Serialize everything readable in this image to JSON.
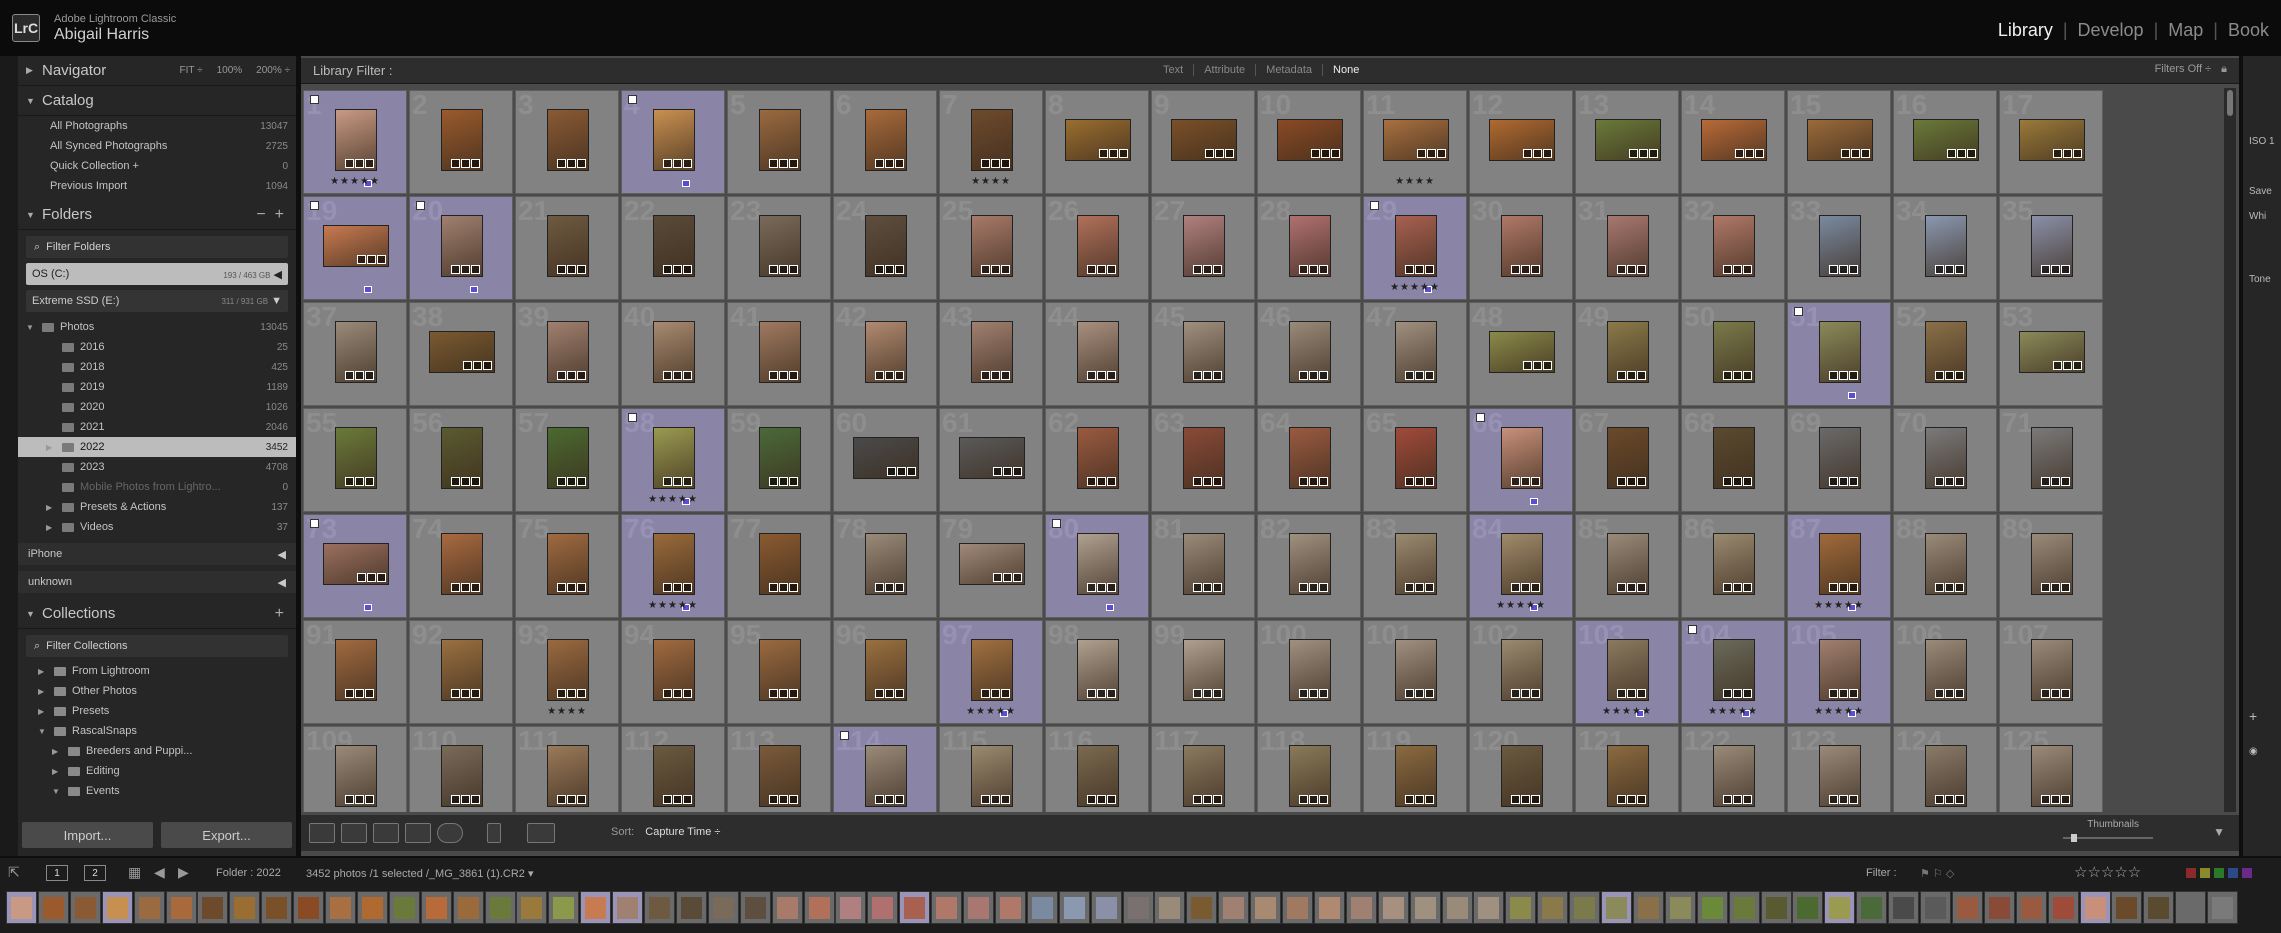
{
  "app": {
    "name": "Adobe Lightroom Classic",
    "user": "Abigail Harris",
    "logo": "LrC"
  },
  "modules": [
    {
      "label": "Library",
      "active": true
    },
    {
      "label": "Develop"
    },
    {
      "label": "Map"
    },
    {
      "label": "Book"
    }
  ],
  "navigator": {
    "title": "Navigator",
    "opts": [
      "FIT ÷",
      "100%",
      "200% ÷"
    ]
  },
  "catalog": {
    "title": "Catalog",
    "items": [
      {
        "label": "All Photographs",
        "count": "13047"
      },
      {
        "label": "All Synced Photographs",
        "count": "2725"
      },
      {
        "label": "Quick Collection +",
        "count": "0"
      },
      {
        "label": "Previous Import",
        "count": "1094"
      }
    ]
  },
  "folders": {
    "title": "Folders",
    "filter": "Filter Folders",
    "volumes": [
      {
        "name": "OS (C:)",
        "usage": "193 / 463 GB"
      },
      {
        "name": "Extreme SSD (E:)",
        "usage": "311 / 931 GB"
      }
    ],
    "items": [
      {
        "label": "Photos",
        "count": "13045",
        "level": 0,
        "tri": "▼"
      },
      {
        "label": "2016",
        "count": "25",
        "level": 1
      },
      {
        "label": "2018",
        "count": "425",
        "level": 1
      },
      {
        "label": "2019",
        "count": "1189",
        "level": 1
      },
      {
        "label": "2020",
        "count": "1026",
        "level": 1
      },
      {
        "label": "2021",
        "count": "2046",
        "level": 1
      },
      {
        "label": "2022",
        "count": "3452",
        "level": 1,
        "tri": "▶",
        "sel": true
      },
      {
        "label": "2023",
        "count": "4708",
        "level": 1
      },
      {
        "label": "Mobile Photos from Lightro...",
        "count": "0",
        "level": 1,
        "dim": true
      },
      {
        "label": "Presets & Actions",
        "count": "137",
        "level": 1,
        "tri": "▶"
      },
      {
        "label": "Videos",
        "count": "37",
        "level": 1,
        "tri": "▶"
      }
    ],
    "devices": [
      {
        "label": "iPhone"
      },
      {
        "label": "unknown"
      }
    ]
  },
  "collections": {
    "title": "Collections",
    "filter": "Filter Collections",
    "items": [
      {
        "label": "From Lightroom",
        "level": 0
      },
      {
        "label": "Other Photos",
        "level": 0
      },
      {
        "label": "Presets",
        "level": 0
      },
      {
        "label": "RascalSnaps",
        "level": 0,
        "open": true
      },
      {
        "label": "Breeders and Puppi...",
        "level": 1
      },
      {
        "label": "Editing",
        "level": 1
      },
      {
        "label": "Events",
        "level": 1,
        "open": true
      }
    ]
  },
  "buttons": {
    "import": "Import...",
    "export": "Export..."
  },
  "filterbar": {
    "title": "Library Filter :",
    "tabs": [
      "Text",
      "Attribute",
      "Metadata",
      "None"
    ],
    "right": "Filters Off ÷"
  },
  "toolbar": {
    "sort_label": "Sort:",
    "sort_value": "Capture Time ÷",
    "thumbs": "Thumbnails"
  },
  "status": {
    "page1": "1",
    "page2": "2",
    "folder": "Folder : 2022",
    "info": "3452 photos /1 selected /_MG_3861 (1).CR2 ▾",
    "filter": "Filter :",
    "stars": "☆☆☆☆☆"
  },
  "right_panel": {
    "items": [
      "Save",
      "Whi",
      "Tone",
      "ISO 1"
    ]
  },
  "colors": {
    "selection": "#8a84a6",
    "panel": "#262626",
    "grid": "#828282",
    "label_purple": "#5a4fd0"
  },
  "grid_rows": [
    {
      "start": 1,
      "cells": [
        {
          "o": "port",
          "c": "#c89a84",
          "sel": true,
          "stars": "★★★★★",
          "label": true,
          "flag": true
        },
        {
          "o": "port",
          "c": "#9a5a2c"
        },
        {
          "o": "port",
          "c": "#8a5a34"
        },
        {
          "o": "port",
          "c": "#c89050",
          "sel": true,
          "label": true,
          "flag": true
        },
        {
          "o": "port",
          "c": "#9a6a40"
        },
        {
          "o": "port",
          "c": "#a86a3a"
        },
        {
          "o": "port",
          "c": "#6e4a2c",
          "stars": "★★★★"
        },
        {
          "o": "land",
          "c": "#9a6e30"
        },
        {
          "o": "land",
          "c": "#7a5028"
        },
        {
          "o": "land",
          "c": "#8a4a24"
        },
        {
          "o": "land",
          "c": "#a87040",
          "stars": "★★★★"
        },
        {
          "o": "land",
          "c": "#b06a30"
        },
        {
          "o": "land",
          "c": "#6a7a3a"
        },
        {
          "o": "land",
          "c": "#b86a38"
        },
        {
          "o": "land",
          "c": "#9a6a3a"
        },
        {
          "o": "land",
          "c": "#6a7a3a"
        },
        {
          "o": "land",
          "c": "#9a7a3a"
        },
        {
          "o": "land",
          "c": "#8a9a4a"
        }
      ]
    },
    {
      "start": 19,
      "cells": [
        {
          "o": "land",
          "c": "#c87a50",
          "sel": true,
          "label": true,
          "flag": true
        },
        {
          "o": "port",
          "c": "#a08070",
          "sel": true,
          "label": true,
          "flag": true
        },
        {
          "o": "port",
          "c": "#6e5a40"
        },
        {
          "o": "port",
          "c": "#5a4a38"
        },
        {
          "o": "port",
          "c": "#7a6a5a"
        },
        {
          "o": "port",
          "c": "#5e4e40"
        },
        {
          "o": "port",
          "c": "#a87a6a"
        },
        {
          "o": "port",
          "c": "#b0705a"
        },
        {
          "o": "port",
          "c": "#b08080"
        },
        {
          "o": "port",
          "c": "#b07070"
        },
        {
          "o": "port",
          "c": "#a86050",
          "sel": true,
          "stars": "★★★★★",
          "label": true,
          "flag": true
        },
        {
          "o": "port",
          "c": "#b07868"
        },
        {
          "o": "port",
          "c": "#a87870"
        },
        {
          "o": "port",
          "c": "#b07868"
        },
        {
          "o": "port",
          "c": "#7a8aa0"
        },
        {
          "o": "port",
          "c": "#8a98b0"
        },
        {
          "o": "port",
          "c": "#8a90a8"
        },
        {
          "o": "port",
          "c": "#7a7070"
        }
      ]
    },
    {
      "start": 37,
      "cells": [
        {
          "o": "port",
          "c": "#9a8a7a"
        },
        {
          "o": "land",
          "c": "#7a5a30"
        },
        {
          "o": "port",
          "c": "#a08070"
        },
        {
          "o": "port",
          "c": "#a88a70"
        },
        {
          "o": "port",
          "c": "#a07a60"
        },
        {
          "o": "port",
          "c": "#b08a70"
        },
        {
          "o": "port",
          "c": "#a08070"
        },
        {
          "o": "port",
          "c": "#a89080"
        },
        {
          "o": "port",
          "c": "#a09080"
        },
        {
          "o": "port",
          "c": "#9a8a7a"
        },
        {
          "o": "port",
          "c": "#a09080"
        },
        {
          "o": "land",
          "c": "#8a8a4a"
        },
        {
          "o": "port",
          "c": "#8a7a4a"
        },
        {
          "o": "port",
          "c": "#7a7a4a"
        },
        {
          "o": "port",
          "c": "#8a8a5a",
          "sel": true,
          "label": true,
          "flag": true
        },
        {
          "o": "port",
          "c": "#8a7048"
        },
        {
          "o": "land",
          "c": "#8a8a5a"
        },
        {
          "o": "port",
          "c": "#6a8a3a"
        }
      ]
    },
    {
      "start": 55,
      "cells": [
        {
          "o": "port",
          "c": "#6a7a3a"
        },
        {
          "o": "port",
          "c": "#5a5a30"
        },
        {
          "o": "port",
          "c": "#4a6a30"
        },
        {
          "o": "port",
          "c": "#9a9a50",
          "sel": true,
          "stars": "★★★★★",
          "label": true,
          "flag": true
        },
        {
          "o": "port",
          "c": "#4a6a3a"
        },
        {
          "o": "land",
          "c": "#4a4a4a"
        },
        {
          "o": "land",
          "c": "#5a5a5a"
        },
        {
          "o": "port",
          "c": "#9a5a40"
        },
        {
          "o": "port",
          "c": "#8a4a38"
        },
        {
          "o": "port",
          "c": "#9a5a40"
        },
        {
          "o": "port",
          "c": "#a04a3a"
        },
        {
          "o": "port",
          "c": "#c8907a",
          "sel": true,
          "label": true,
          "flag": true
        },
        {
          "o": "port",
          "c": "#6a4a2a"
        },
        {
          "o": "port",
          "c": "#5a4a30"
        },
        {
          "o": "port",
          "c": "#6a6a6a"
        },
        {
          "o": "port",
          "c": "#7a7a7a"
        },
        {
          "o": "port",
          "c": "#7a7a7a"
        },
        {
          "o": "port",
          "c": "#6a6a6a",
          "stars": "★★★"
        },
        {
          "o": "port",
          "c": "#5a5a5a"
        }
      ]
    },
    {
      "start": 73,
      "cells": [
        {
          "o": "land",
          "c": "#9a7060",
          "sel": true,
          "label": true,
          "flag": true
        },
        {
          "o": "port",
          "c": "#a86a40"
        },
        {
          "o": "port",
          "c": "#a06a40"
        },
        {
          "o": "port",
          "c": "#9a6a3a",
          "sel": true,
          "stars": "★★★★★",
          "label": true
        },
        {
          "o": "port",
          "c": "#8a5a30"
        },
        {
          "o": "port",
          "c": "#9a8a7a"
        },
        {
          "o": "land",
          "c": "#a08a7a"
        },
        {
          "o": "port",
          "c": "#b0a090",
          "sel": true,
          "label": true,
          "flag": true
        },
        {
          "o": "port",
          "c": "#9a8a7a"
        },
        {
          "o": "port",
          "c": "#a09080"
        },
        {
          "o": "port",
          "c": "#9a8a70"
        },
        {
          "o": "port",
          "c": "#a08a6a",
          "sel": true,
          "stars": "★★★★★",
          "label": true
        },
        {
          "o": "port",
          "c": "#9a8a7a"
        },
        {
          "o": "port",
          "c": "#9a8a70"
        },
        {
          "o": "port",
          "c": "#a06a3a",
          "sel": true,
          "stars": "★★★★★",
          "label": true
        },
        {
          "o": "port",
          "c": "#9a8a7a"
        },
        {
          "o": "port",
          "c": "#9a8a7a"
        },
        {
          "o": "port",
          "c": "#8a7a6a",
          "stars": "★★★★"
        }
      ]
    },
    {
      "start": 91,
      "cells": [
        {
          "o": "port",
          "c": "#a06a40"
        },
        {
          "o": "port",
          "c": "#9a7040"
        },
        {
          "o": "port",
          "c": "#9a6a40",
          "stars": "★★★★"
        },
        {
          "o": "port",
          "c": "#a06a40"
        },
        {
          "o": "port",
          "c": "#9a6a40"
        },
        {
          "o": "port",
          "c": "#9a7040"
        },
        {
          "o": "port",
          "c": "#a07040",
          "sel": true,
          "stars": "★★★★★",
          "label": true
        },
        {
          "o": "port",
          "c": "#b0a090"
        },
        {
          "o": "port",
          "c": "#b0a090"
        },
        {
          "o": "port",
          "c": "#a09080"
        },
        {
          "o": "port",
          "c": "#a09080"
        },
        {
          "o": "port",
          "c": "#9a8a70"
        },
        {
          "o": "port",
          "c": "#8a7a60",
          "sel": true,
          "stars": "★★★★★",
          "label": true
        },
        {
          "o": "port",
          "c": "#6a6a5a",
          "sel": true,
          "stars": "★★★★★",
          "label": true,
          "flag": true
        },
        {
          "o": "port",
          "c": "#a08070",
          "sel": true,
          "stars": "★★★★★",
          "label": true
        },
        {
          "o": "port",
          "c": "#9a8a7a"
        },
        {
          "o": "port",
          "c": "#9a8a7a"
        },
        {
          "o": "port",
          "c": "#9a7a60"
        },
        {
          "o": "port",
          "c": "#a07040"
        }
      ]
    },
    {
      "start": 109,
      "cells": [
        {
          "o": "port",
          "c": "#9a8a7a"
        },
        {
          "o": "port",
          "c": "#7a6a5a"
        },
        {
          "o": "port",
          "c": "#9a7a5a"
        },
        {
          "o": "port",
          "c": "#6a5a40"
        },
        {
          "o": "port",
          "c": "#7a5a3a"
        },
        {
          "o": "port",
          "c": "#9a8a7a",
          "sel": true,
          "flag": true
        },
        {
          "o": "port",
          "c": "#9a8a70"
        },
        {
          "o": "port",
          "c": "#7a6a50"
        },
        {
          "o": "port",
          "c": "#8a7a60"
        },
        {
          "o": "port",
          "c": "#8a7a5a"
        },
        {
          "o": "port",
          "c": "#8a6a40"
        },
        {
          "o": "port",
          "c": "#6a5a40"
        },
        {
          "o": "port",
          "c": "#8a6a40"
        },
        {
          "o": "port",
          "c": "#9a8a7a"
        },
        {
          "o": "port",
          "c": "#9a8a7a"
        },
        {
          "o": "port",
          "c": "#8a7a6a"
        },
        {
          "o": "port",
          "c": "#9a8a7a"
        },
        {
          "o": "port",
          "c": "#8a7a6a"
        }
      ]
    }
  ]
}
